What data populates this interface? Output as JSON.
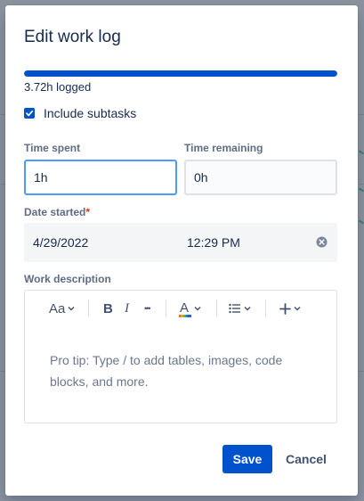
{
  "dialog": {
    "title": "Edit work log"
  },
  "progress": {
    "logged_text": "3.72h logged",
    "fill_fraction": 1.0,
    "color": "#0052cc"
  },
  "include_subtasks": {
    "label": "Include subtasks",
    "checked": true
  },
  "time_spent": {
    "label": "Time spent",
    "value": "1h"
  },
  "time_remaining": {
    "label": "Time remaining",
    "value": "0h"
  },
  "date_started": {
    "label": "Date started",
    "required_mark": "*",
    "date": "4/29/2022",
    "time": "12:29 PM"
  },
  "work_description": {
    "label": "Work description",
    "placeholder": "Pro tip: Type / to add tables, images, code blocks, and more.",
    "toolbar": {
      "text_style": "Aa",
      "bold": "B",
      "italic": "I",
      "more": "•••",
      "text_color": "A",
      "icons": [
        "text-style-icon",
        "bold-icon",
        "italic-icon",
        "more-formatting-icon",
        "text-color-icon",
        "bullet-list-icon",
        "insert-plus-icon"
      ]
    }
  },
  "actions": {
    "save_label": "Save",
    "cancel_label": "Cancel"
  },
  "colors": {
    "primary": "#0052cc",
    "focus_border": "#4c9aff",
    "required": "#de350b",
    "label": "#5e6c84"
  }
}
